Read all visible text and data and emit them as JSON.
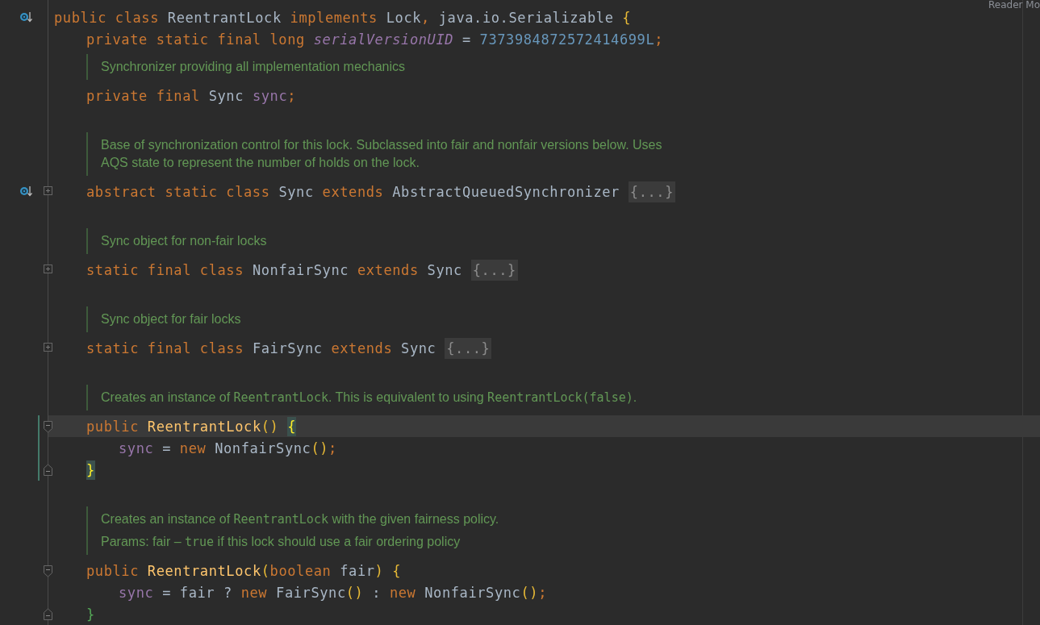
{
  "reader_mode_label": "Reader Mo",
  "rows": [
    {
      "kind": "code",
      "gutter": [
        {
          "kind": "override"
        }
      ],
      "changed": false,
      "tokens": [
        {
          "kind": "kw",
          "text": "public class "
        },
        {
          "kind": "plain",
          "text": "ReentrantLock "
        },
        {
          "kind": "kw",
          "text": "implements "
        },
        {
          "kind": "plain",
          "text": "Lock"
        },
        {
          "kind": "punct",
          "text": ", "
        },
        {
          "kind": "plain",
          "text": "java.io.Serializable "
        },
        {
          "kind": "bracket",
          "text": "{"
        }
      ],
      "children": [
        {
          "kind": "code",
          "changed": false,
          "tokens": [
            {
              "kind": "kw",
              "text": "private static final long "
            },
            {
              "kind": "static_field",
              "text": "serialVersionUID"
            },
            {
              "kind": "plain",
              "text": " = "
            },
            {
              "kind": "number",
              "text": "7373984872572414699L"
            },
            {
              "kind": "punct",
              "text": ";"
            }
          ]
        },
        {
          "kind": "doc",
          "lines": [
            [
              {
                "kind": "prose",
                "text": "Synchronizer providing all implementation mechanics"
              }
            ]
          ]
        },
        {
          "kind": "code",
          "changed": false,
          "tokens": [
            {
              "kind": "kw",
              "text": "private final "
            },
            {
              "kind": "plain",
              "text": "Sync "
            },
            {
              "kind": "field",
              "text": "sync"
            },
            {
              "kind": "punct",
              "text": ";"
            }
          ]
        },
        {
          "kind": "blank"
        },
        {
          "kind": "doc",
          "lines": [
            [
              {
                "kind": "prose",
                "text": "Base of synchronization control for this lock. Subclassed into fair and nonfair versions below. Uses"
              }
            ],
            [
              {
                "kind": "prose",
                "text": "AQS state to represent the number of holds on the lock."
              }
            ]
          ]
        },
        {
          "kind": "code",
          "gutter": [
            {
              "kind": "override"
            },
            {
              "kind": "fold_collapsed"
            }
          ],
          "changed": false,
          "tokens": [
            {
              "kind": "kw",
              "text": "abstract static class "
            },
            {
              "kind": "plain",
              "text": "Sync "
            },
            {
              "kind": "kw",
              "text": "extends "
            },
            {
              "kind": "plain",
              "text": "AbstractQueuedSynchronizer "
            },
            {
              "kind": "folded",
              "text": "{...}"
            }
          ]
        },
        {
          "kind": "blank"
        },
        {
          "kind": "doc",
          "lines": [
            [
              {
                "kind": "prose",
                "text": "Sync object for non-fair locks"
              }
            ]
          ]
        },
        {
          "kind": "code",
          "gutter": [
            {
              "kind": "fold_collapsed"
            }
          ],
          "changed": false,
          "tokens": [
            {
              "kind": "kw",
              "text": "static final class "
            },
            {
              "kind": "plain",
              "text": "NonfairSync "
            },
            {
              "kind": "kw",
              "text": "extends "
            },
            {
              "kind": "plain",
              "text": "Sync "
            },
            {
              "kind": "folded",
              "text": "{...}"
            }
          ]
        },
        {
          "kind": "blank"
        },
        {
          "kind": "doc",
          "lines": [
            [
              {
                "kind": "prose",
                "text": "Sync object for fair locks"
              }
            ]
          ]
        },
        {
          "kind": "code",
          "gutter": [
            {
              "kind": "fold_collapsed"
            }
          ],
          "changed": false,
          "tokens": [
            {
              "kind": "kw",
              "text": "static final class "
            },
            {
              "kind": "plain",
              "text": "FairSync "
            },
            {
              "kind": "kw",
              "text": "extends "
            },
            {
              "kind": "plain",
              "text": "Sync "
            },
            {
              "kind": "folded",
              "text": "{...}"
            }
          ]
        },
        {
          "kind": "blank"
        },
        {
          "kind": "doc",
          "lines": [
            [
              {
                "kind": "prose",
                "text": "Creates an instance of "
              },
              {
                "kind": "code",
                "text": "ReentrantLock"
              },
              {
                "kind": "prose",
                "text": ". This is equivalent to using "
              },
              {
                "kind": "code",
                "text": "ReentrantLock(false)"
              },
              {
                "kind": "prose",
                "text": "."
              }
            ]
          ]
        },
        {
          "kind": "code",
          "gutter": [
            {
              "kind": "fold_start"
            }
          ],
          "current": true,
          "changed": true,
          "tokens": [
            {
              "kind": "kw",
              "text": "public "
            },
            {
              "kind": "method",
              "text": "ReentrantLock"
            },
            {
              "kind": "bracket",
              "text": "() "
            },
            {
              "kind": "brace_match",
              "text": "{"
            }
          ],
          "children": [
            {
              "kind": "code",
              "changed": true,
              "tokens": [
                {
                  "kind": "field",
                  "text": "sync"
                },
                {
                  "kind": "plain",
                  "text": " = "
                },
                {
                  "kind": "kw",
                  "text": "new "
                },
                {
                  "kind": "plain",
                  "text": "NonfairSync"
                },
                {
                  "kind": "bracket",
                  "text": "()"
                },
                {
                  "kind": "punct",
                  "text": ";"
                }
              ]
            }
          ]
        },
        {
          "kind": "code",
          "gutter": [
            {
              "kind": "fold_end"
            }
          ],
          "changed": true,
          "tokens": [
            {
              "kind": "brace_match",
              "text": "}"
            }
          ]
        },
        {
          "kind": "blank"
        },
        {
          "kind": "doc",
          "lines": [
            [
              {
                "kind": "prose",
                "text": "Creates an instance of "
              },
              {
                "kind": "code",
                "text": "ReentrantLock"
              },
              {
                "kind": "prose",
                "text": " with the given fairness policy."
              }
            ]
          ],
          "params": [
            {
              "kind": "prose",
              "text": "Params: fair – "
            },
            {
              "kind": "code",
              "text": "true"
            },
            {
              "kind": "prose",
              "text": " if this lock should use a fair ordering policy"
            }
          ]
        },
        {
          "kind": "code",
          "gutter": [
            {
              "kind": "fold_start"
            }
          ],
          "changed": false,
          "tokens": [
            {
              "kind": "kw",
              "text": "public "
            },
            {
              "kind": "method",
              "text": "ReentrantLock"
            },
            {
              "kind": "bracket",
              "text": "("
            },
            {
              "kind": "kw",
              "text": "boolean "
            },
            {
              "kind": "plain",
              "text": "fair"
            },
            {
              "kind": "bracket",
              "text": ") {"
            }
          ],
          "children": [
            {
              "kind": "code",
              "changed": false,
              "tokens": [
                {
                  "kind": "field",
                  "text": "sync"
                },
                {
                  "kind": "plain",
                  "text": " = fair ? "
                },
                {
                  "kind": "kw",
                  "text": "new "
                },
                {
                  "kind": "plain",
                  "text": "FairSync"
                },
                {
                  "kind": "bracket",
                  "text": "()"
                },
                {
                  "kind": "plain",
                  "text": " : "
                },
                {
                  "kind": "kw",
                  "text": "new "
                },
                {
                  "kind": "plain",
                  "text": "NonfairSync"
                },
                {
                  "kind": "bracket",
                  "text": "()"
                },
                {
                  "kind": "punct",
                  "text": ";"
                }
              ]
            }
          ]
        },
        {
          "kind": "code",
          "gutter": [
            {
              "kind": "fold_end"
            }
          ],
          "changed": false,
          "tokens": [
            {
              "kind": "bracket2",
              "text": "}"
            }
          ]
        }
      ]
    }
  ]
}
